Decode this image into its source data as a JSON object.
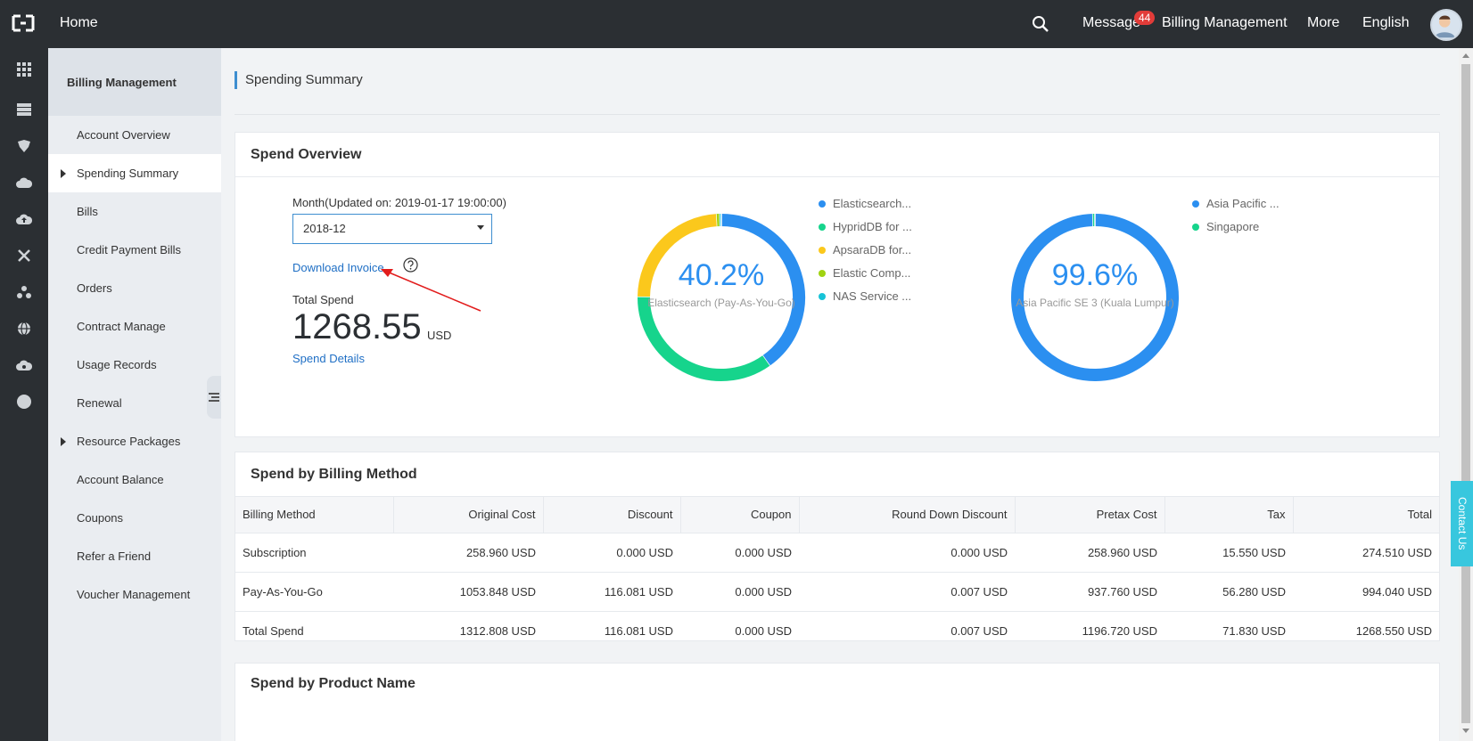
{
  "topbar": {
    "home": "Home",
    "message": "Message",
    "message_count": "44",
    "billing": "Billing Management",
    "more": "More",
    "language": "English"
  },
  "rail_icons": [
    "apps-grid-icon",
    "server-icon",
    "security-icon",
    "cloud-icon",
    "cloud-upload-icon",
    "network-icon",
    "cluster-icon",
    "globe-icon",
    "cloud-settings-icon",
    "circle-icon"
  ],
  "sidebar": {
    "title": "Billing Management",
    "items": [
      {
        "label": "Account Overview",
        "caret": false
      },
      {
        "label": "Spending Summary",
        "caret": true
      },
      {
        "label": "Bills",
        "caret": false
      },
      {
        "label": "Credit Payment Bills",
        "caret": false
      },
      {
        "label": "Orders",
        "caret": false
      },
      {
        "label": "Contract Manage",
        "caret": false
      },
      {
        "label": "Usage Records",
        "caret": false
      },
      {
        "label": "Renewal",
        "caret": false
      },
      {
        "label": "Resource Packages",
        "caret": true
      },
      {
        "label": "Account Balance",
        "caret": false
      },
      {
        "label": "Coupons",
        "caret": false
      },
      {
        "label": "Refer a Friend",
        "caret": false
      },
      {
        "label": "Voucher Management",
        "caret": false
      }
    ]
  },
  "page": {
    "title": "Spending Summary"
  },
  "overview": {
    "title": "Spend Overview",
    "month_label": "Month(Updated on: 2019-01-17 19:00:00)",
    "month_value": "2018-12",
    "download_invoice": "Download Invoice",
    "total_label": "Total Spend",
    "total_value": "1268.55",
    "total_unit": "USD",
    "spend_details": "Spend Details"
  },
  "chart_data": [
    {
      "type": "pie",
      "center_value": "40.2%",
      "center_label": "Elasticsearch (Pay-As-You-Go)",
      "legend": [
        {
          "label": "Elasticsearch...",
          "color": "#2b8ff0"
        },
        {
          "label": "HypridDB for ...",
          "color": "#16d48c"
        },
        {
          "label": "ApsaraDB for...",
          "color": "#fbc81c"
        },
        {
          "label": "Elastic Comp...",
          "color": "#a0d311"
        },
        {
          "label": "NAS Service ...",
          "color": "#17c3d7"
        }
      ],
      "values": [
        40.2,
        35.0,
        23.9,
        0.6,
        0.3
      ]
    },
    {
      "type": "pie",
      "center_value": "99.6%",
      "center_label": "Asia Pacific SE 3 (Kuala Lumpur)",
      "legend": [
        {
          "label": "Asia Pacific ...",
          "color": "#2b8ff0"
        },
        {
          "label": "Singapore",
          "color": "#16d48c"
        }
      ],
      "values": [
        99.6,
        0.4
      ]
    }
  ],
  "billing_method": {
    "title": "Spend by Billing Method",
    "columns": [
      "Billing Method",
      "Original Cost",
      "Discount",
      "Coupon",
      "Round Down Discount",
      "Pretax Cost",
      "Tax",
      "Total"
    ],
    "rows": [
      [
        "Subscription",
        "258.960 USD",
        "0.000 USD",
        "0.000 USD",
        "0.000 USD",
        "258.960 USD",
        "15.550 USD",
        "274.510 USD"
      ],
      [
        "Pay-As-You-Go",
        "1053.848 USD",
        "116.081 USD",
        "0.000 USD",
        "0.007 USD",
        "937.760 USD",
        "56.280 USD",
        "994.040 USD"
      ],
      [
        "Total Spend",
        "1312.808 USD",
        "116.081 USD",
        "0.000 USD",
        "0.007 USD",
        "1196.720 USD",
        "71.830 USD",
        "1268.550 USD"
      ]
    ]
  },
  "product": {
    "title": "Spend by Product Name"
  },
  "contact": "Contact Us"
}
